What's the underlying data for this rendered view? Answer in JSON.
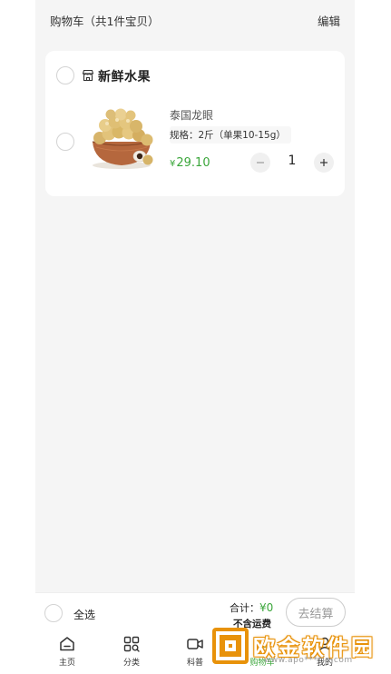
{
  "header": {
    "title": "购物车（共1件宝贝）",
    "edit_label": "编辑"
  },
  "shop": {
    "name": "新鲜水果",
    "icon": "store-icon"
  },
  "cart_item": {
    "name": "泰国龙眼",
    "spec": "规格：2斤（单果10-15g）",
    "currency": "¥",
    "price": "29.10",
    "quantity": "1",
    "image": "longan-fruit-bowl"
  },
  "bottom_bar": {
    "select_all_label": "全选",
    "total_label": "合计：",
    "total_value": "¥0",
    "shipping_note": "不含运费",
    "checkout_label": "去结算"
  },
  "tabs": [
    {
      "label": "主页",
      "icon": "home-icon"
    },
    {
      "label": "分类",
      "icon": "category-grid-icon"
    },
    {
      "label": "科普",
      "icon": "video-icon"
    },
    {
      "label": "购物车",
      "icon": "cart-icon"
    },
    {
      "label": "我的",
      "icon": "user-icon"
    }
  ],
  "watermark": {
    "text": "欧金软件园",
    "url": "www.apo****in.com"
  },
  "colors": {
    "accent_green": "#3aa63a",
    "watermark_orange": "#e8920a"
  }
}
